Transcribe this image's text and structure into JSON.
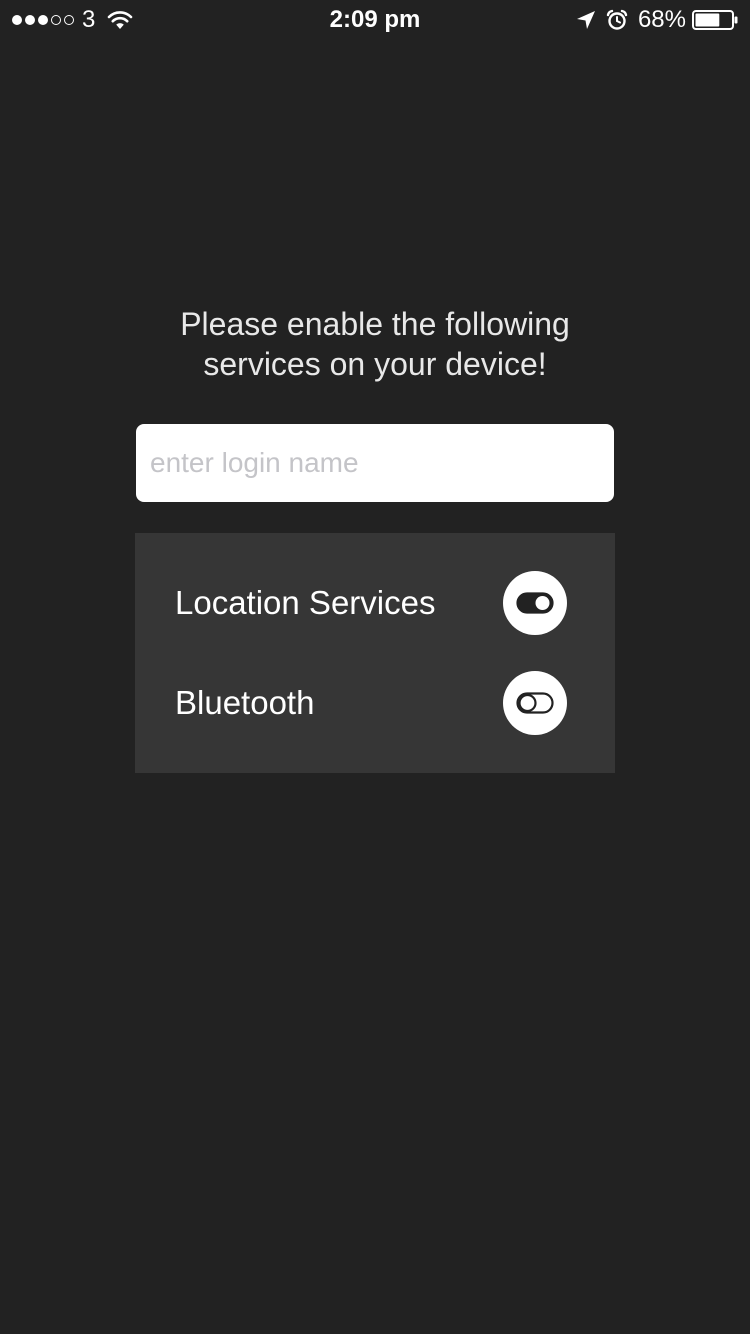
{
  "status_bar": {
    "signal_bars_filled": 3,
    "signal_bars_total": 5,
    "carrier": "3",
    "time": "2:09 pm",
    "battery_percent": "68%",
    "battery_level": 0.68,
    "icons": [
      "wifi-icon",
      "location-arrow-icon",
      "alarm-icon",
      "battery-icon"
    ]
  },
  "main": {
    "prompt_line1": "Please enable the following",
    "prompt_line2": "services on your device!",
    "login_input": {
      "placeholder": "enter login name",
      "value": ""
    },
    "services": [
      {
        "label": "Location Services",
        "enabled": true,
        "icon": "toggle-on-icon"
      },
      {
        "label": "Bluetooth",
        "enabled": false,
        "icon": "toggle-off-icon"
      }
    ]
  },
  "colors": {
    "background": "#222222",
    "panel": "#363636",
    "text": "#ffffff",
    "placeholder": "#c4c4c8",
    "toggle_circle": "#ffffff"
  }
}
